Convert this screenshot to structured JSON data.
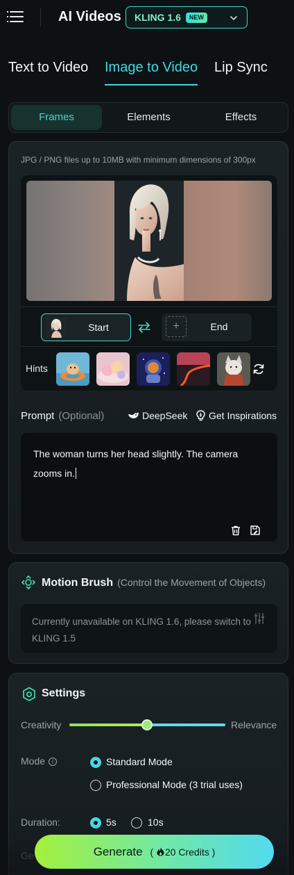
{
  "header": {
    "title": "AI Videos",
    "model_name": "KLING 1.6",
    "new_badge": "NEW",
    "menu_icon": "hamburger-icon",
    "dropdown_icon": "chevron-down-icon"
  },
  "mode_tabs": [
    {
      "label": "Text to Video",
      "active": false
    },
    {
      "label": "Image to Video",
      "active": true
    },
    {
      "label": "Lip Sync",
      "active": false
    }
  ],
  "sub_tabs": [
    {
      "label": "Frames",
      "active": true
    },
    {
      "label": "Elements",
      "active": false
    },
    {
      "label": "Effects",
      "active": false
    }
  ],
  "frames": {
    "file_hint": "JPG / PNG files up to 10MB with minimum dimensions of 300px",
    "start_label": "Start",
    "end_label": "End",
    "end_placeholder": "+",
    "hints_label": "Hints"
  },
  "prompt": {
    "label": "Prompt",
    "optional": "(Optional)",
    "deepseek": "DeepSeek",
    "inspirations": "Get Inspirations",
    "text": "The woman turns her head slightly. The camera zooms in."
  },
  "motion_brush": {
    "title": "Motion Brush",
    "subtitle": "(Control the Movement of Objects)",
    "note": "Currently unavailable on KLING 1.6, please switch to KLING 1.5"
  },
  "settings": {
    "title": "Settings",
    "creativity_label": "Creativity",
    "relevance_label": "Relevance",
    "slider_value": 0.5,
    "mode_label": "Mode",
    "info_glyph": "i",
    "mode_standard": "Standard Mode",
    "mode_professional": "Professional Mode (3 trial uses)",
    "duration_label": "Duration:",
    "duration_5": "5s",
    "duration_10": "10s",
    "partial_label": "Ge"
  },
  "generate": {
    "label": "Generate",
    "credits_count": "20",
    "credits_word": "Credits"
  },
  "colors": {
    "accent": "#43d9e4",
    "teal_border": "#3fd9c6",
    "background": "#0d1114",
    "generate_gradient_start": "#a4f03c",
    "generate_gradient_end": "#52d9f0"
  }
}
